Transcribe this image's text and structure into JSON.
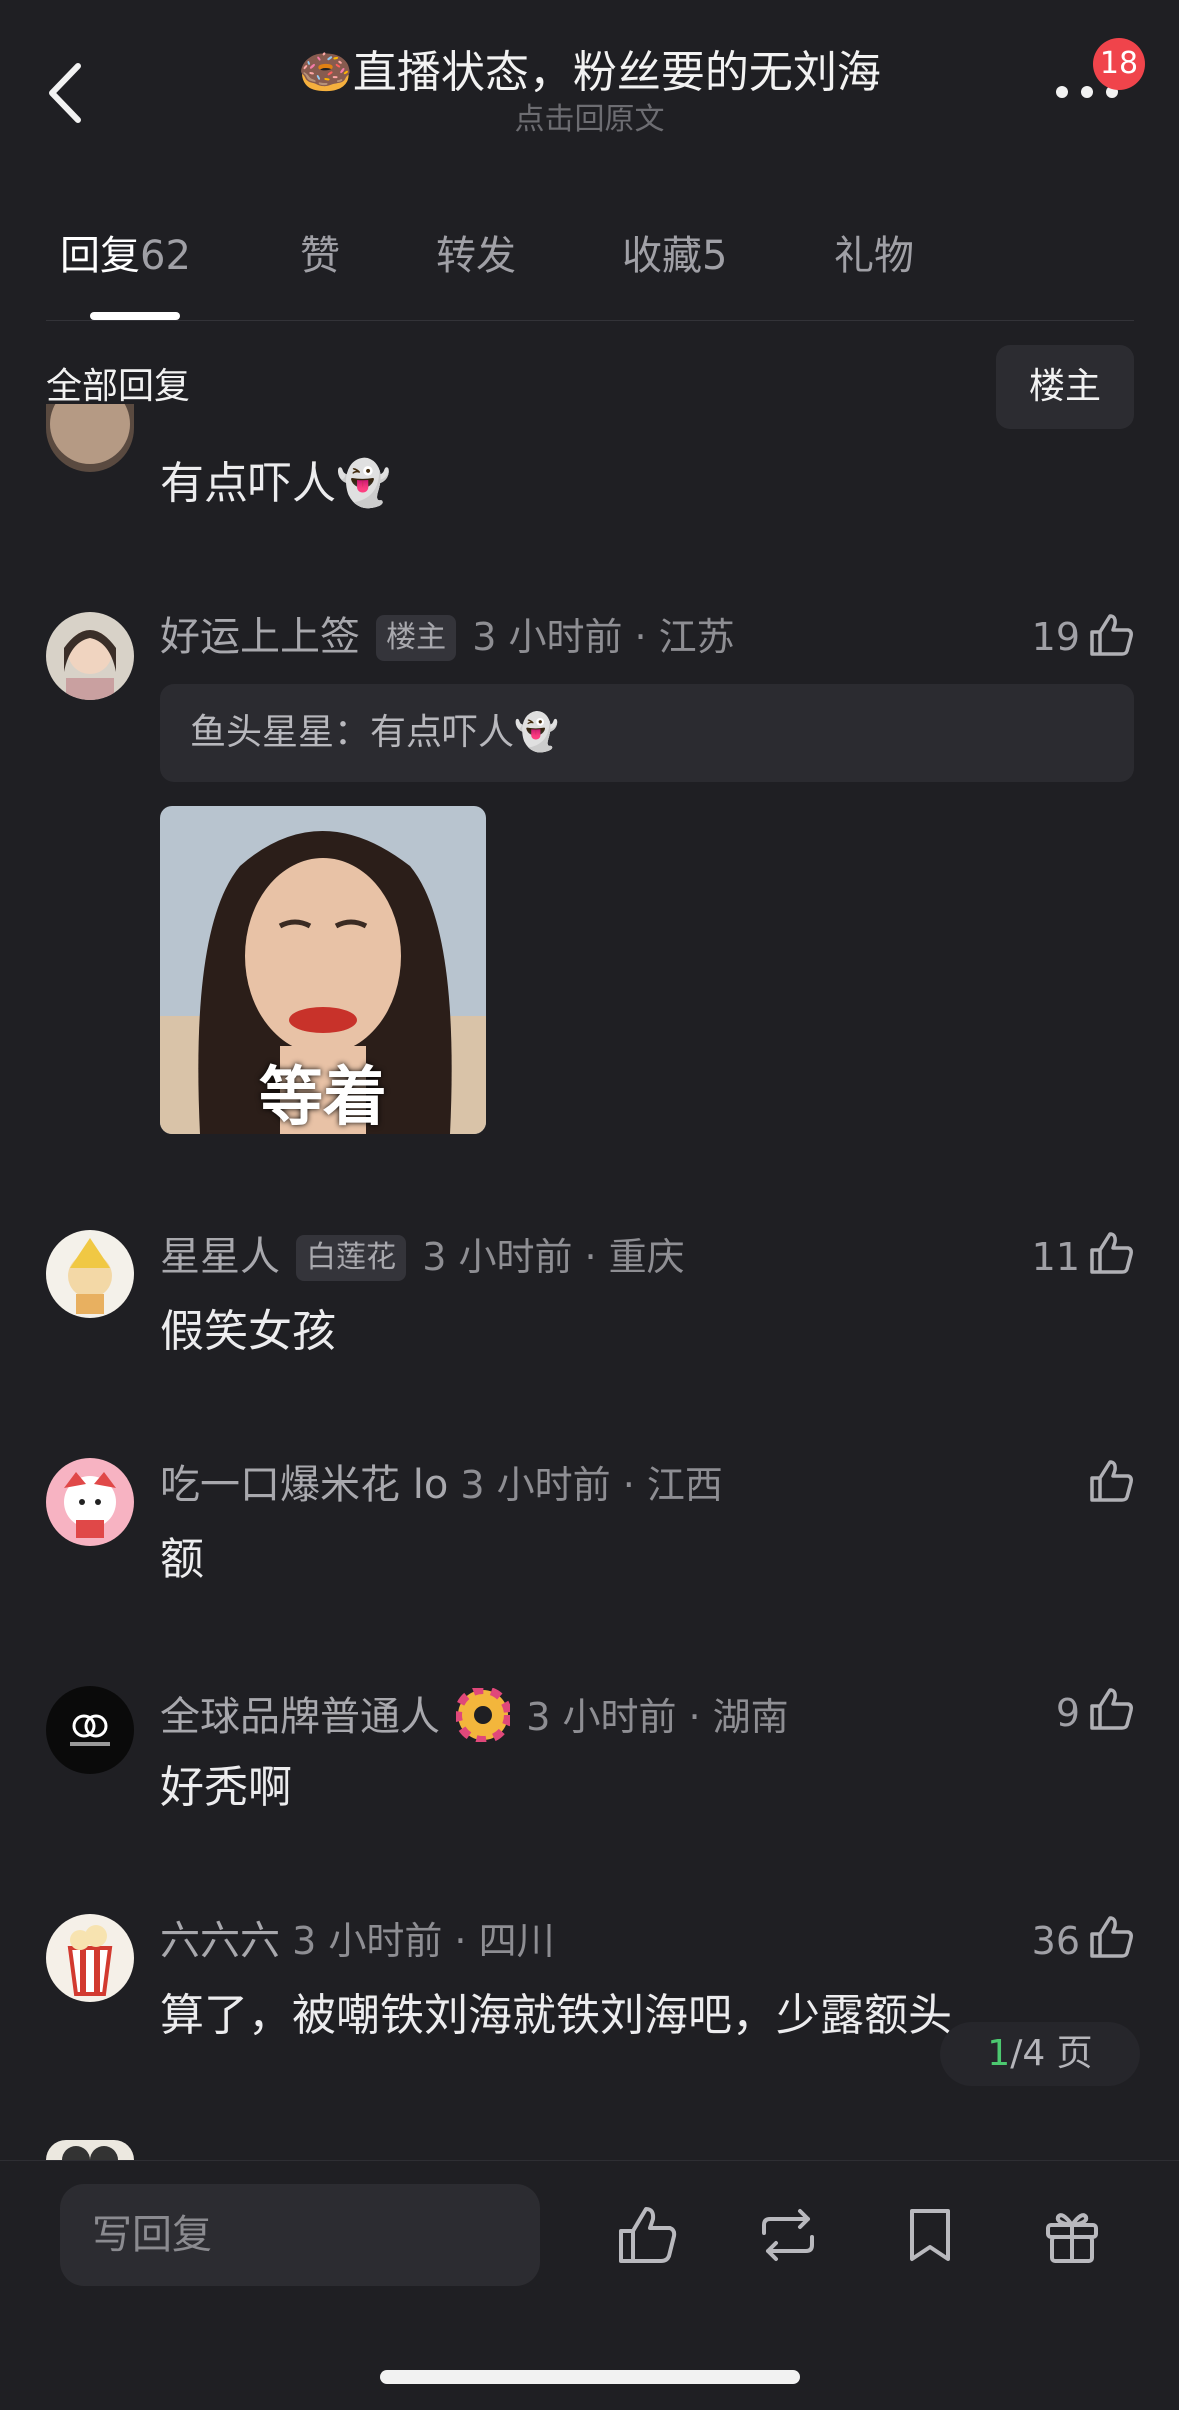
{
  "header": {
    "title": "🍩直播状态，粉丝要的无刘海",
    "subtitle": "点击回原文",
    "notification_count": "18"
  },
  "tabs": [
    {
      "label": "回复",
      "count": "62",
      "active": true
    },
    {
      "label": "赞",
      "count": ""
    },
    {
      "label": "转发",
      "count": ""
    },
    {
      "label": "收藏",
      "count": "5"
    },
    {
      "label": "礼物",
      "count": ""
    }
  ],
  "section": {
    "title": "全部回复",
    "owner_filter": "楼主"
  },
  "comments": [
    {
      "body": "有点吓人👻"
    },
    {
      "name": "好运上上签",
      "tag": "楼主",
      "time_location": "3 小时前 · 江苏",
      "likes": "19",
      "quote": "鱼头星星：有点吓人👻",
      "image_caption": "等着"
    },
    {
      "name": "星星人",
      "tag": "白莲花",
      "time_location": "3 小时前 · 重庆",
      "likes": "11",
      "body": "假笑女孩"
    },
    {
      "name": "吃一口爆米花 lo",
      "time_location": "3 小时前 · 江西",
      "likes": "",
      "body": "额"
    },
    {
      "name": "全球品牌普通人",
      "time_location": "3 小时前 · 湖南",
      "likes": "9",
      "body": "好秃啊"
    },
    {
      "name": "六六六",
      "time_location": "3 小时前 · 四川",
      "likes": "36",
      "body": "算了，被嘲铁刘海就铁刘海吧，少露额头"
    }
  ],
  "pager": {
    "current": "1",
    "total": "/4 页"
  },
  "bottom": {
    "reply_placeholder": "写回复"
  },
  "colors": {
    "accent_green": "#4cc870",
    "badge_red": "#f0444b",
    "background": "#1f1f23"
  }
}
